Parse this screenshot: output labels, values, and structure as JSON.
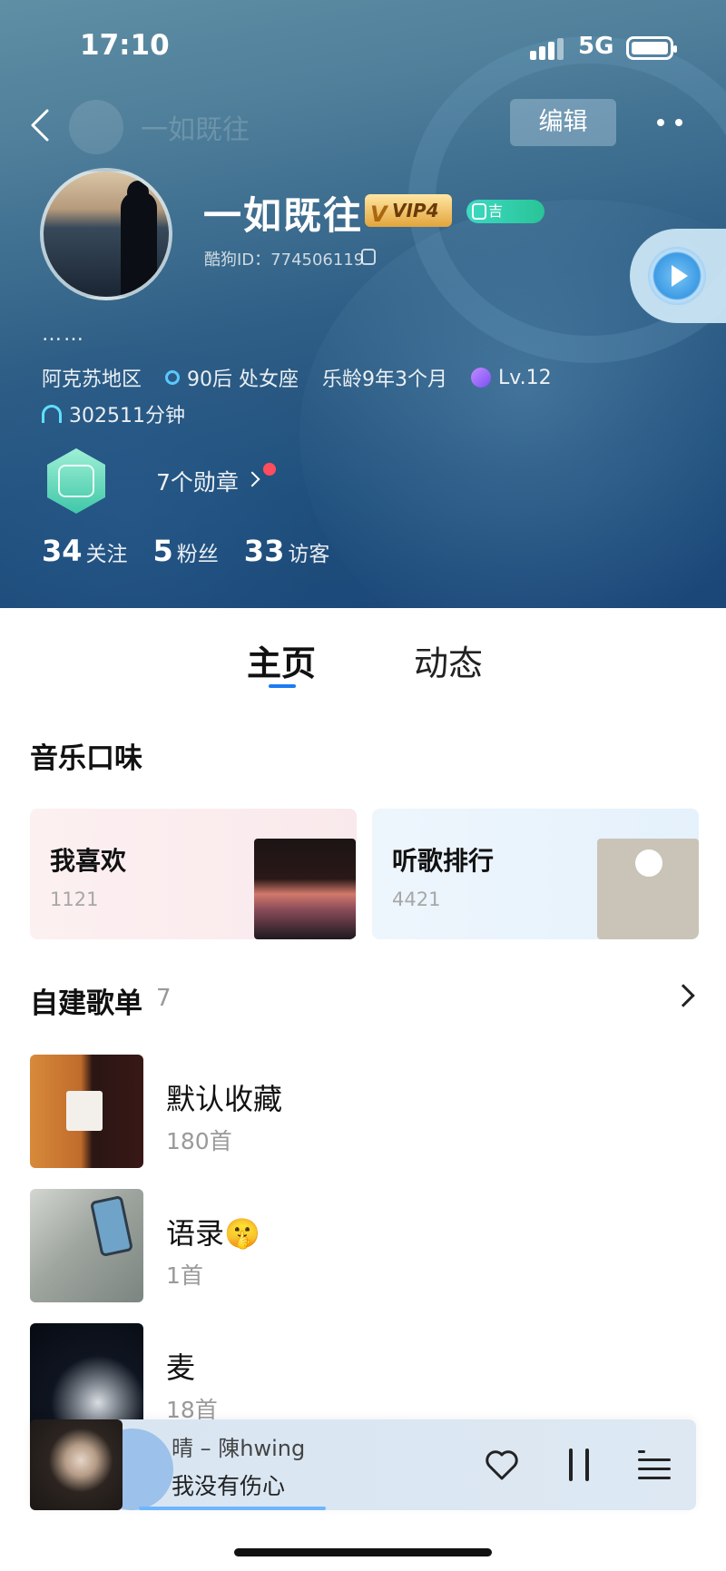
{
  "status_bar": {
    "time": "17:10",
    "network": "5G"
  },
  "header": {
    "ghost_title": "一如既往",
    "edit_label": "编辑",
    "username": "一如既往",
    "vip_label": "VIP4",
    "tag_label": "吉",
    "kugou_id": "酷狗ID：774506119",
    "bio": "……",
    "region": "阿克苏地区",
    "age_sign": "90后 处女座",
    "music_age": "乐龄9年3个月",
    "level": "Lv.12",
    "listen_time": "302511分钟",
    "medals": "7个勋章",
    "stats": [
      {
        "num": "34",
        "label": "关注"
      },
      {
        "num": "5",
        "label": "粉丝"
      },
      {
        "num": "33",
        "label": "访客"
      }
    ]
  },
  "tabs": {
    "main": "主页",
    "dynamic": "动态"
  },
  "music_taste": {
    "title": "音乐口味",
    "cards": [
      {
        "title": "我喜欢",
        "count": "1121"
      },
      {
        "title": "听歌排行",
        "count": "4421"
      }
    ]
  },
  "playlists": {
    "title": "自建歌单",
    "count": "7",
    "items": [
      {
        "name": "默认收藏",
        "count": "180首"
      },
      {
        "name": "语录🤫",
        "count": "1首"
      },
      {
        "name": "麦",
        "count": "18首"
      }
    ]
  },
  "player": {
    "song": "晴 – 陳hwing",
    "lyric": "我没有伤心",
    "progress": 0.28
  },
  "colors": {
    "accent": "#1a7df0",
    "header_bg": "#2f5f86",
    "badge_green": "#3fc7a8"
  }
}
